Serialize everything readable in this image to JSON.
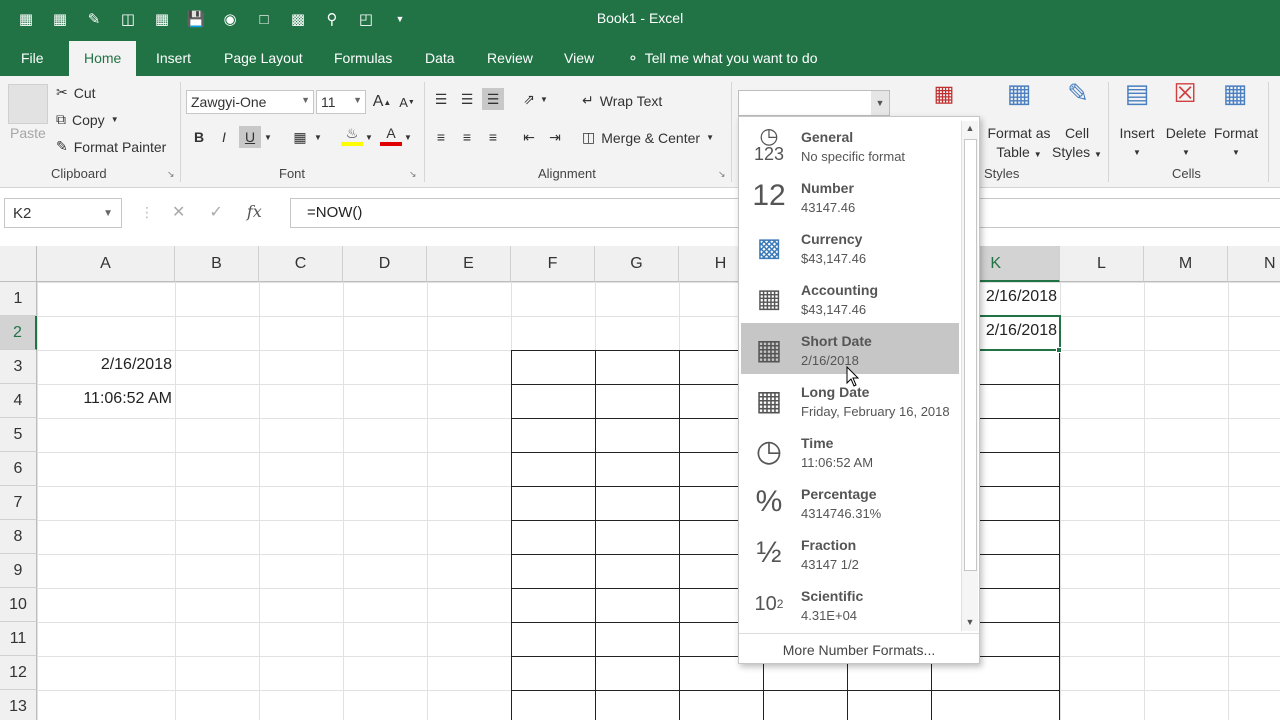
{
  "window": {
    "title": "Book1 - Excel"
  },
  "qat": {
    "icons": [
      "calculator-icon",
      "calculator-icon",
      "eraser-icon",
      "table-icon",
      "grid-icon",
      "save-icon",
      "camera-icon",
      "new-file-icon",
      "insert-table-icon",
      "print-preview-icon",
      "open-folder-icon",
      "customize-caret-icon"
    ]
  },
  "tabs": [
    {
      "label": "File"
    },
    {
      "label": "Home"
    },
    {
      "label": "Insert"
    },
    {
      "label": "Page Layout"
    },
    {
      "label": "Formulas"
    },
    {
      "label": "Data"
    },
    {
      "label": "Review"
    },
    {
      "label": "View"
    }
  ],
  "tellme": "Tell me what you want to do",
  "ribbon": {
    "clipboard": {
      "paste": "Paste",
      "cut": "Cut",
      "copy": "Copy",
      "format_painter": "Format Painter",
      "label": "Clipboard"
    },
    "font": {
      "name": "Zawgyi-One",
      "size": "11",
      "bold": "B",
      "italic": "I",
      "underline": "U",
      "grow": "A",
      "shrink": "A",
      "label": "Font"
    },
    "alignment": {
      "wrap": "Wrap Text",
      "merge": "Merge & Center",
      "label": "Alignment"
    },
    "styles": {
      "format_as_table_1": "Format as",
      "format_as_table_2": "Table",
      "cell_styles_1": "Cell",
      "cell_styles_2": "Styles",
      "label": "Styles"
    },
    "cells": {
      "insert": "Insert",
      "delete": "Delete",
      "format": "Format",
      "label": "Cells"
    }
  },
  "formula_bar": {
    "name_box": "K2",
    "formula": "=NOW()"
  },
  "columns": [
    "A",
    "B",
    "C",
    "D",
    "E",
    "F",
    "G",
    "H",
    "K",
    "L",
    "M",
    "N"
  ],
  "rows": [
    "1",
    "2",
    "3",
    "4",
    "5",
    "6",
    "7",
    "8",
    "9",
    "10",
    "11",
    "12",
    "13"
  ],
  "cells": {
    "A3": "2/16/2018",
    "A4": "11:06:52 AM",
    "K1": "2/16/2018",
    "K2": "2/16/2018"
  },
  "number_format_dropdown": {
    "items": [
      {
        "title": "General",
        "sample": "No specific format",
        "icon": "clock-123-icon"
      },
      {
        "title": "Number",
        "sample": "43147.46",
        "icon": "number-12-icon"
      },
      {
        "title": "Currency",
        "sample": "$43,147.46",
        "icon": "currency-icon"
      },
      {
        "title": "Accounting",
        "sample": "$43,147.46",
        "icon": "accounting-icon"
      },
      {
        "title": "Short Date",
        "sample": "2/16/2018",
        "icon": "calendar-icon"
      },
      {
        "title": "Long Date",
        "sample": "Friday, February 16, 2018",
        "icon": "calendar-icon"
      },
      {
        "title": "Time",
        "sample": "11:06:52 AM",
        "icon": "clock-icon"
      },
      {
        "title": "Percentage",
        "sample": "4314746.31%",
        "icon": "percent-icon"
      },
      {
        "title": "Fraction",
        "sample": "43147 1/2",
        "icon": "fraction-icon"
      },
      {
        "title": "Scientific",
        "sample": "4.31E+04",
        "icon": "scientific-icon"
      }
    ],
    "more": "More Number Formats...",
    "highlighted": "Short Date",
    "icon_glyphs": {
      "number": "12",
      "percent": "%",
      "fraction": "½",
      "scientific_base": "10",
      "scientific_exp": "2",
      "general_num": "123"
    }
  },
  "colors": {
    "accent": "#217346",
    "highlight": "#c6c6c6"
  }
}
